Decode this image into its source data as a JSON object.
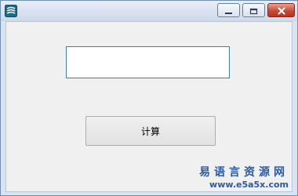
{
  "window": {
    "title": "",
    "app_icon": "app-logo-icon"
  },
  "titlebar_buttons": {
    "minimize_icon": "minimize-icon",
    "maximize_icon": "maximize-icon",
    "close_icon": "close-icon"
  },
  "form": {
    "input_value": "",
    "button_label": "计算"
  },
  "watermark": {
    "text": "易语言资源网",
    "url": "www.e5a5x.com"
  },
  "colors": {
    "accent": "#3c7fb1",
    "close_button": "#c74a35",
    "watermark": "#2a5aa8"
  }
}
